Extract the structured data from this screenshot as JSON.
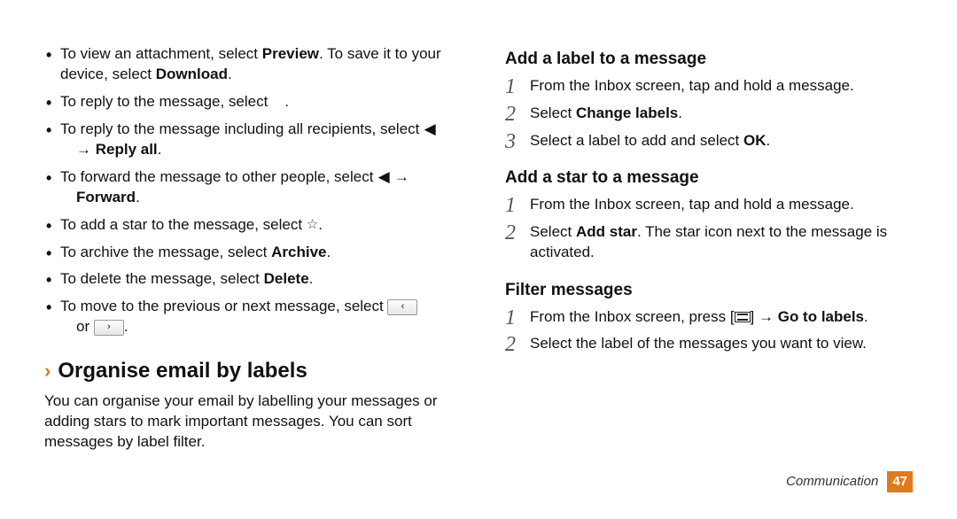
{
  "left": {
    "bullets": [
      {
        "pre": "To view an attachment, select ",
        "bold1": "Preview",
        "mid": ". To save it to your device, select ",
        "bold2": "Download",
        "post": "."
      },
      {
        "pre": "To reply to the message, select ",
        "post": "."
      },
      {
        "pre": "To reply to the message including all recipients, select ",
        "afterIcon": " → ",
        "boldLine2": "Reply all",
        "post2": "."
      },
      {
        "pre": "To forward the message to other people, select ",
        "afterIcon": " → ",
        "boldLine2": "Forward",
        "post2": "."
      },
      {
        "pre": "To add a star to the message, select ",
        "post": "."
      },
      {
        "pre": "To archive the message, select ",
        "bold1": "Archive",
        "post": "."
      },
      {
        "pre": "To delete the message, select ",
        "bold1": "Delete",
        "post": "."
      },
      {
        "pre": "To move to the previous or next message, select ",
        "orText": " or ",
        "post": "."
      }
    ],
    "section": {
      "caret": "›",
      "title": "Organise email by labels",
      "para": "You can organise your email by labelling your messages or adding stars to mark important messages. You can sort messages by label filter."
    }
  },
  "right": {
    "addLabel": {
      "heading": "Add a label to a message",
      "steps": [
        {
          "pre": "From the Inbox screen, tap and hold a message."
        },
        {
          "pre": "Select ",
          "bold": "Change labels",
          "post": "."
        },
        {
          "pre": "Select a label to add and select ",
          "bold": "OK",
          "post": "."
        }
      ]
    },
    "addStar": {
      "heading": "Add a star to a message",
      "steps": [
        {
          "pre": "From the Inbox screen, tap and hold a message."
        },
        {
          "pre": "Select ",
          "bold": "Add star",
          "post": ". The star icon next to the message is activated."
        }
      ]
    },
    "filter": {
      "heading": "Filter messages",
      "steps": [
        {
          "pre": "From the Inbox screen, press [",
          "afterIcon": "] → ",
          "bold": "Go to labels",
          "post": "."
        },
        {
          "pre": "Select the label of the messages you want to view."
        }
      ]
    }
  },
  "footer": {
    "section": "Communication",
    "page": "47"
  },
  "nums": [
    "1",
    "2",
    "3"
  ]
}
